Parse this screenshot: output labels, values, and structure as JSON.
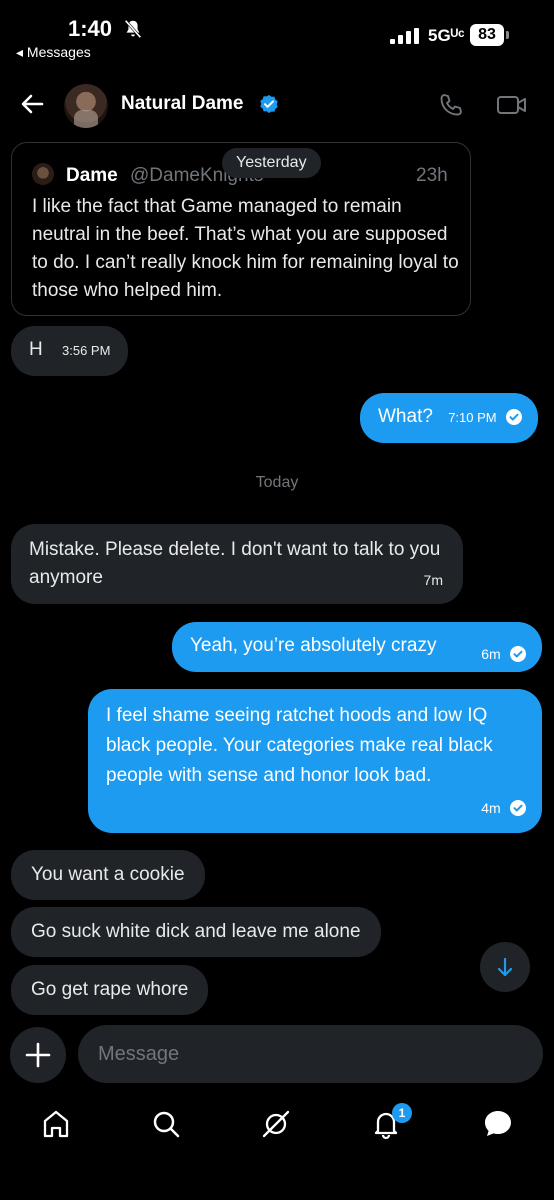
{
  "status_bar": {
    "time": "1:40",
    "back_app": "◂ Messages",
    "network": "5Gᵁᶜ",
    "battery": "83"
  },
  "header": {
    "contact_name": "Natural Dame",
    "verified": true
  },
  "quoted_post": {
    "author_name": "Dame",
    "author_handle": "@DameKnights",
    "time": "23h",
    "text": "I like the fact that Game managed to remain neutral in the beef. That’s what you are supposed to do. I can’t really knock him for remaining loyal to those who helped him."
  },
  "day_labels": {
    "yesterday": "Yesterday",
    "today": "Today"
  },
  "messages": [
    {
      "from": "them",
      "text": "H",
      "time": "3:56 PM"
    },
    {
      "from": "me",
      "text": "What?",
      "time": "7:10 PM"
    },
    {
      "from": "them",
      "text": "Mistake. Please delete. I don't want to talk to you anymore",
      "time": "7m"
    },
    {
      "from": "me",
      "text": "Yeah, you’re absolutely crazy",
      "time": "6m"
    },
    {
      "from": "me",
      "text": "I feel shame seeing ratchet hoods and low IQ black people. Your categories make real black people with sense and honor look bad.",
      "time": "4m"
    },
    {
      "from": "them",
      "text": "You want a cookie"
    },
    {
      "from": "them",
      "text": "Go suck white dick and leave me alone"
    },
    {
      "from": "them",
      "text": "Go get rape whore"
    }
  ],
  "composer": {
    "placeholder": "Message"
  },
  "tab_bar": {
    "items": [
      "home-icon",
      "search-icon",
      "grok-icon",
      "notifications-icon",
      "messages-icon"
    ],
    "notifications_count": "1"
  },
  "colors": {
    "accent": "#1d9bf0",
    "incoming_bubble": "#202327",
    "background": "#000000",
    "secondary_text": "#71767b"
  }
}
